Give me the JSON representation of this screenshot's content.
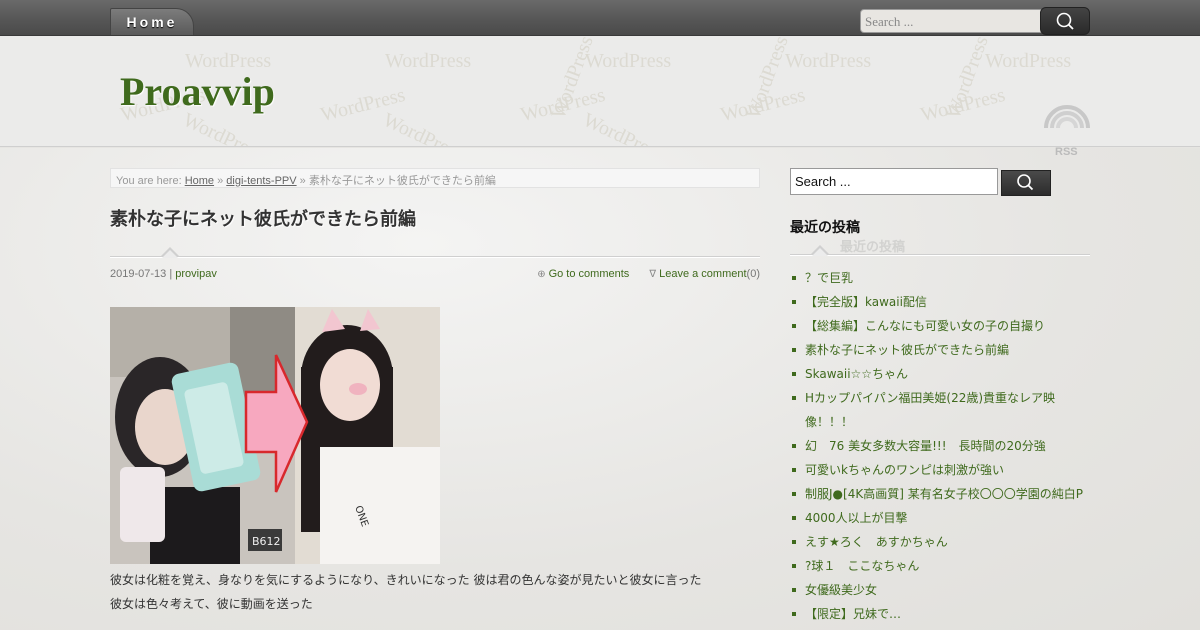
{
  "nav": {
    "home_label": "Home",
    "search_placeholder": "Search ..."
  },
  "header": {
    "site_title": "Proavvip",
    "watermark_text": "WordPress",
    "rss_label": "RSS"
  },
  "breadcrumb": {
    "prefix": "You are here: ",
    "home": "Home",
    "sep1": " » ",
    "category": "digi-tents-PPV",
    "sep2": " » ",
    "current": "素朴な子にネット彼氏ができたら前編"
  },
  "post": {
    "title": "素朴な子にネット彼氏ができたら前編",
    "date": "2019-07-13",
    "separator": " | ",
    "author": "provipav",
    "comments_symbol": "⊕",
    "go_to_comments": "Go to comments",
    "leave_symbol": "∇",
    "leave_comment": "Leave a comment",
    "comment_count": "(0)",
    "image_badge": "B612",
    "body_line1": "彼女は化粧を覚え、身なりを気にするようになり、きれいになった 彼は君の色んな姿が見たいと彼女に言った",
    "body_line2": "彼女は色々考えて、彼に動画を送った"
  },
  "sidebar": {
    "search_value": "Search ...",
    "recent_title": "最近の投稿",
    "recent_posts": [
      "？で巨乳",
      "【完全版】kawaii配信",
      "【総集編】こんなにも可愛い女の子の自撮り",
      "素朴な子にネット彼氏ができたら前編",
      "Skawaii☆☆ちゃん",
      "Hカップパイパン福田美姫(22歳)貴重なレア映",
      "像！！！",
      "幻　76 美女多数大容量!!!　長時間の20分強",
      "可愛いkちゃんのワンピは刺激が強い",
      "制服J●[4K高画質] 某有名女子校〇〇〇学園の純白P",
      "4000人以上が目撃",
      "えす★ろく　あすかちゃん",
      "?球１　ここなちゃん",
      "女優級美少女",
      "【限定】兄妹で…"
    ]
  },
  "colors": {
    "accent_green": "#3f6a1d",
    "nav_dark": "#555555",
    "background": "#e6e5e2"
  }
}
